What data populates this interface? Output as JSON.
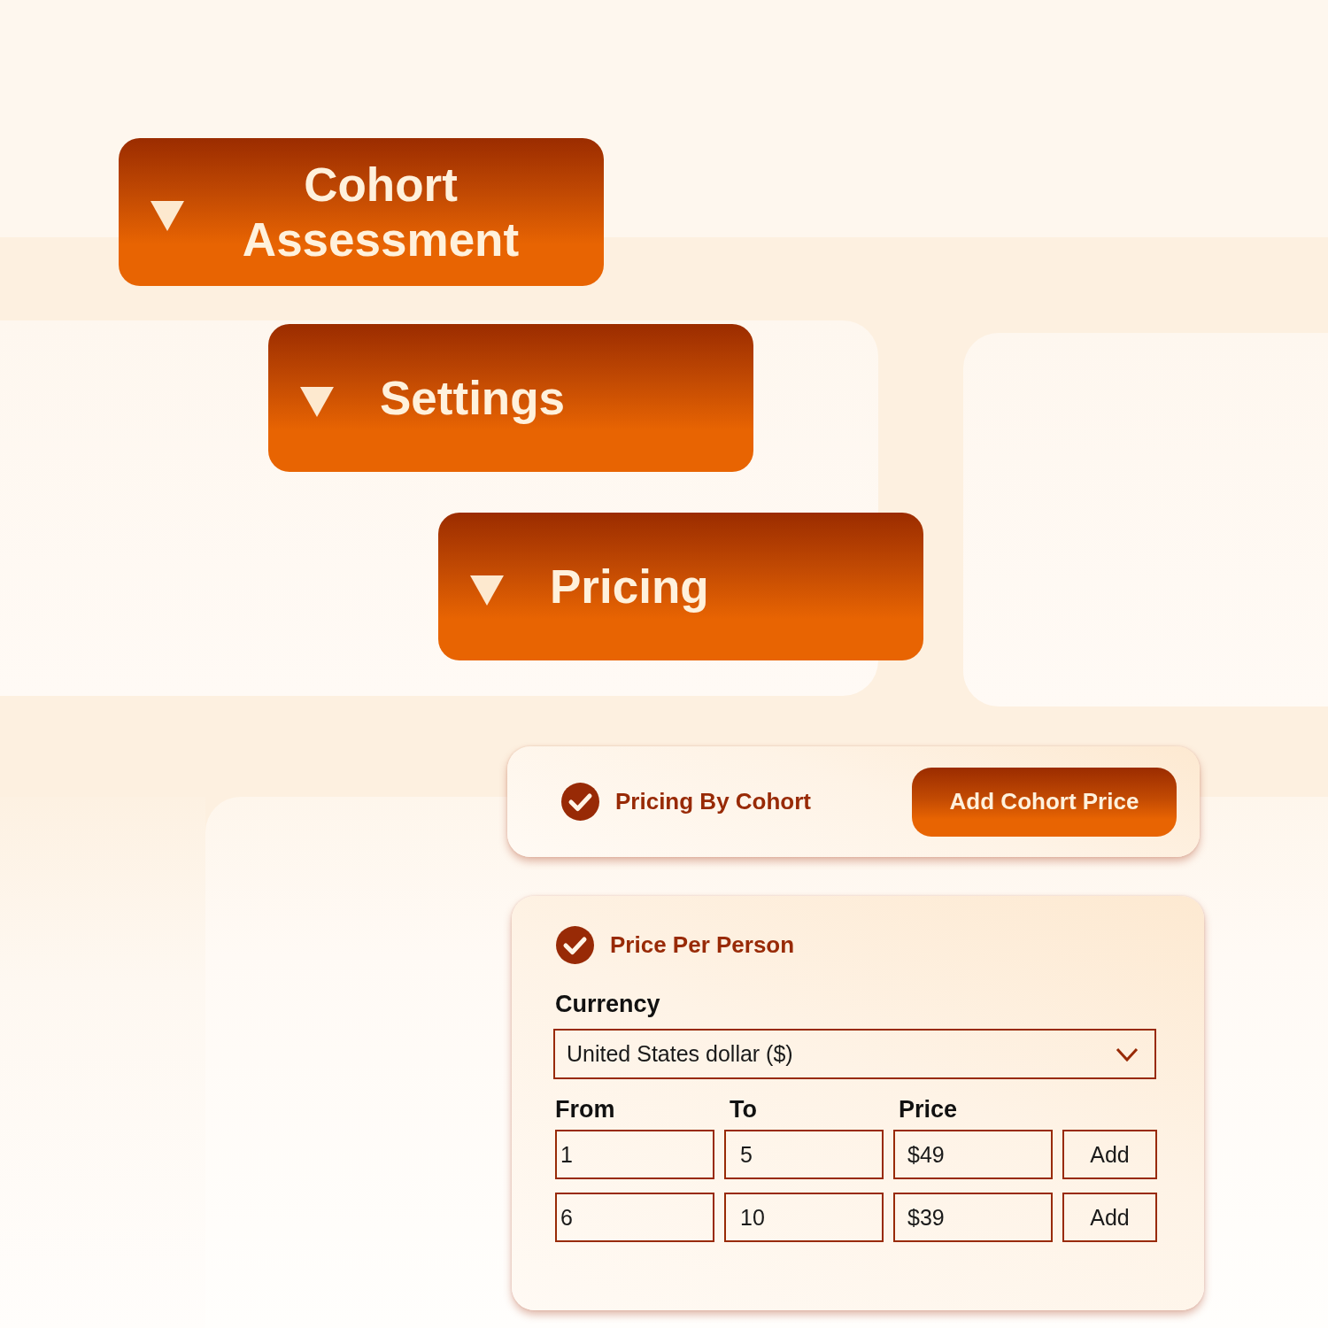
{
  "sections": [
    {
      "title": "Cohort Assessment",
      "expanded": true
    },
    {
      "title": "Settings",
      "expanded": true
    },
    {
      "title": "Pricing",
      "expanded": true
    }
  ],
  "pricing_by_cohort": {
    "label": "Pricing By Cohort",
    "checked": true,
    "button": "Add Cohort Price"
  },
  "price_per_person": {
    "label": "Price Per Person",
    "checked": true,
    "currency": {
      "label": "Currency",
      "value": "United States dollar ($)"
    },
    "columns": [
      "From",
      "To",
      "Price"
    ],
    "rows": [
      {
        "from": "1",
        "to": "5",
        "price": "$49",
        "button": "Add"
      },
      {
        "from": "6",
        "to": "10",
        "price": "$39",
        "button": "Add"
      }
    ]
  }
}
